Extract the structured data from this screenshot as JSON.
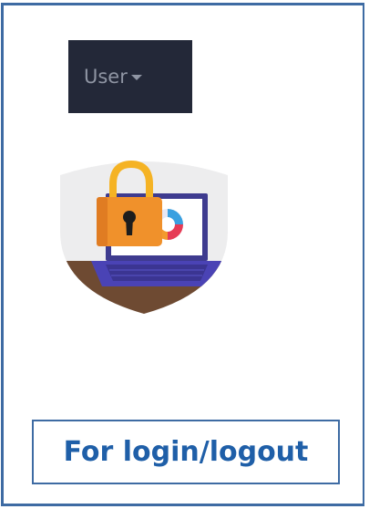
{
  "user_menu": {
    "label": "User",
    "caret_icon": "caret-down-icon",
    "background": "#232838",
    "text_color": "#8f95a3"
  },
  "illustration": {
    "icon": "padlock-laptop-security-icon"
  },
  "caption": {
    "text": "For login/logout",
    "color": "#1f5fa8",
    "border_color": "#3e6ba3"
  }
}
